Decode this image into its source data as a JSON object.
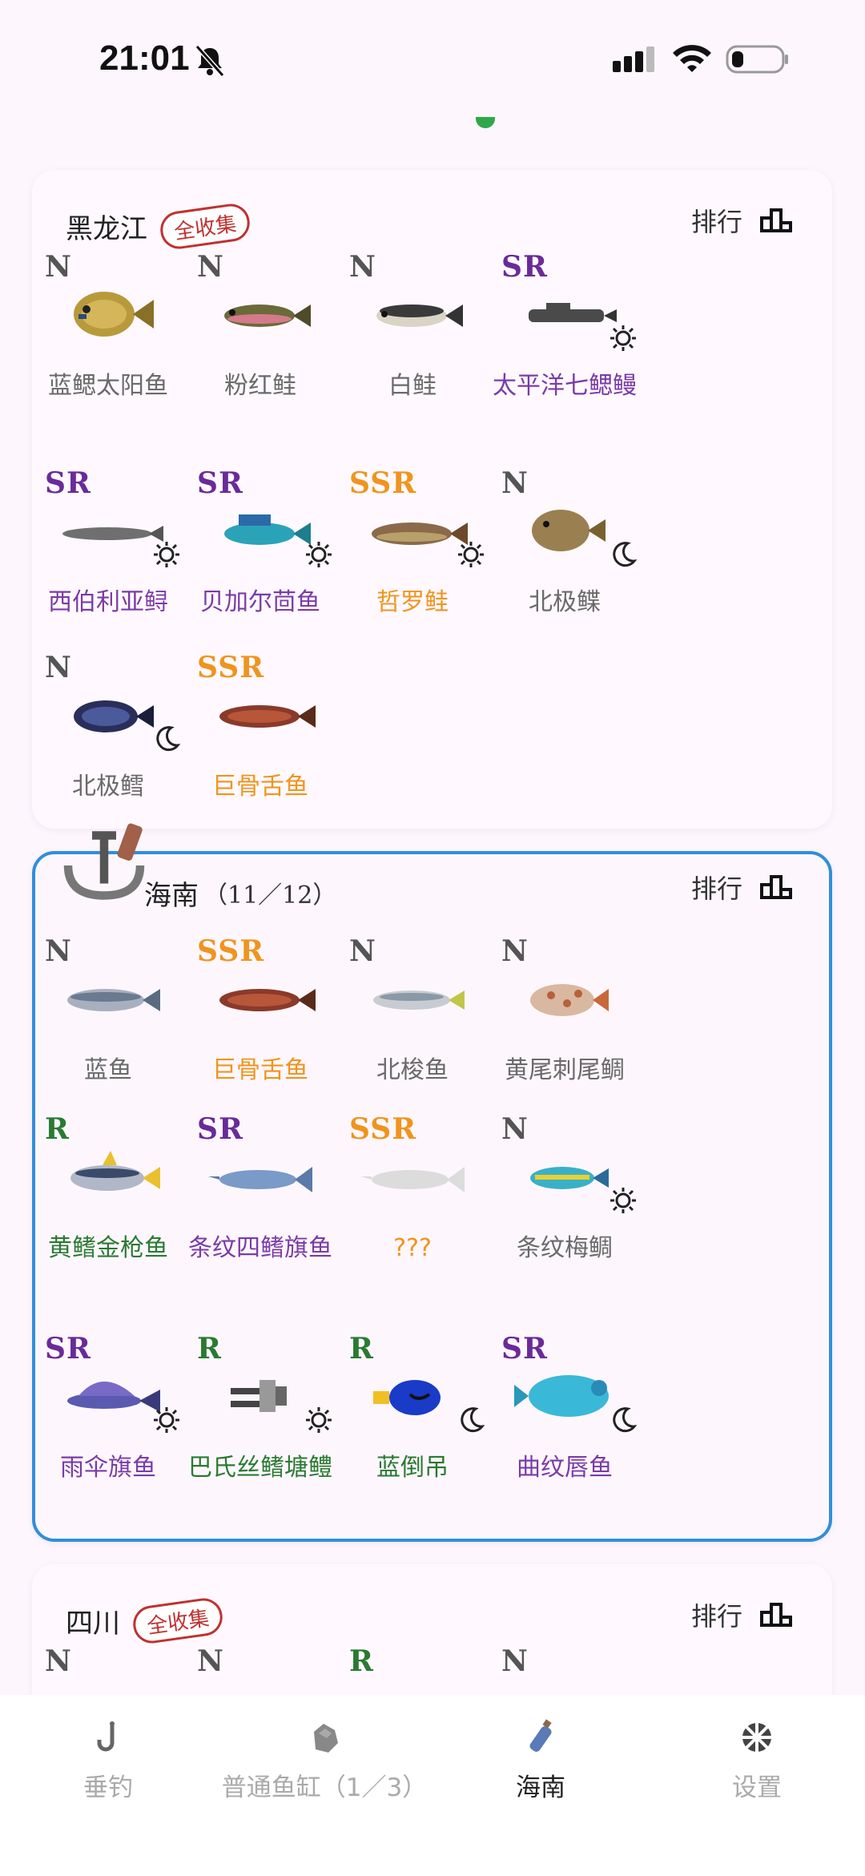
{
  "status_bar": {
    "time": "21:01"
  },
  "sections": [
    {
      "region": "黑龙江",
      "badge": "全收集",
      "rank_label": "排行",
      "fish": [
        {
          "rarity": "N",
          "name": "蓝鳃太阳鱼"
        },
        {
          "rarity": "N",
          "name": "粉红鲑"
        },
        {
          "rarity": "N",
          "name": "白鲑"
        },
        {
          "rarity": "SR",
          "name": "太平洋七鳃鳗",
          "tag": "weather-icon"
        },
        {
          "rarity": "SR",
          "name": "西伯利亚鲟",
          "tag": "weather-icon"
        },
        {
          "rarity": "SR",
          "name": "贝加尔茴鱼",
          "tag": "weather-icon"
        },
        {
          "rarity": "SSR",
          "name": "哲罗鲑",
          "tag": "weather-icon"
        },
        {
          "rarity": "N",
          "name": "北极鲽",
          "tag": "moon-icon"
        },
        {
          "rarity": "N",
          "name": "北极鳕",
          "tag": "moon-icon"
        },
        {
          "rarity": "SSR",
          "name": "巨骨舌鱼"
        }
      ]
    },
    {
      "region": "海南",
      "progress": "（11／12）",
      "rank_label": "排行",
      "fish": [
        {
          "rarity": "N",
          "name": "蓝鱼"
        },
        {
          "rarity": "SSR",
          "name": "巨骨舌鱼"
        },
        {
          "rarity": "N",
          "name": "北梭鱼"
        },
        {
          "rarity": "N",
          "name": "黄尾刺尾鲷"
        },
        {
          "rarity": "R",
          "name": "黄鳍金枪鱼"
        },
        {
          "rarity": "SR",
          "name": "条纹四鳍旗鱼"
        },
        {
          "rarity": "SSR",
          "name": "???"
        },
        {
          "rarity": "N",
          "name": "条纹梅鲷",
          "tag": "weather-icon"
        },
        {
          "rarity": "SR",
          "name": "雨伞旗鱼",
          "tag": "weather-icon"
        },
        {
          "rarity": "R",
          "name": "巴氏丝鳍塘鳢",
          "tag": "weather-icon"
        },
        {
          "rarity": "R",
          "name": "蓝倒吊",
          "tag": "moon-icon"
        },
        {
          "rarity": "SR",
          "name": "曲纹唇鱼",
          "tag": "moon-icon"
        }
      ]
    },
    {
      "region": "四川",
      "badge": "全收集",
      "rank_label": "排行",
      "fish": [
        {
          "rarity": "N"
        },
        {
          "rarity": "N"
        },
        {
          "rarity": "R"
        },
        {
          "rarity": "N"
        }
      ]
    }
  ],
  "tabs": [
    {
      "label": "垂钓",
      "icon": "hook-icon"
    },
    {
      "label": "普通鱼缸（1／3）",
      "icon": "stone-icon"
    },
    {
      "label": "海南",
      "icon": "bottle-icon",
      "active": true
    },
    {
      "label": "设置",
      "icon": "settings-icon"
    }
  ],
  "colors": {
    "accent": "#2e8fdc",
    "badge": "#c0312f",
    "N": "#555555",
    "R": "#2a7a32",
    "SR": "#6a2a9a",
    "SSR": "#f0941e"
  }
}
